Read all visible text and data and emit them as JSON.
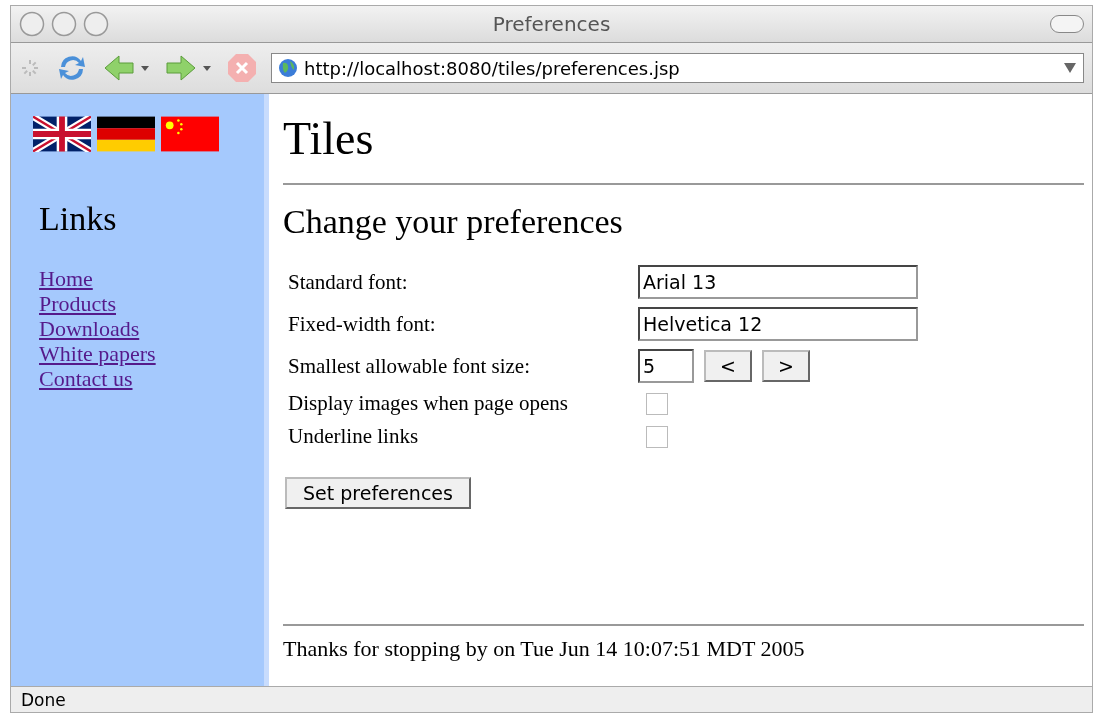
{
  "window": {
    "title": "Preferences"
  },
  "toolbar": {
    "url": "http://localhost:8080/tiles/preferences.jsp"
  },
  "sidebar": {
    "flags": [
      {
        "kind": "uk"
      },
      {
        "kind": "de"
      },
      {
        "kind": "cn"
      }
    ],
    "heading": "Links",
    "links": [
      "Home",
      "Products",
      "Downloads",
      "White papers",
      "Contact us"
    ]
  },
  "main": {
    "title": "Tiles",
    "heading": "Change your preferences",
    "form": [
      {
        "kind": "text",
        "label": "Standard font:",
        "value": "Arial 13"
      },
      {
        "kind": "text",
        "label": "Fixed-width font:",
        "value": "Helvetica 12"
      },
      {
        "kind": "stepper",
        "label": "Smallest allowable font size:",
        "value": "5",
        "buttons": [
          "<",
          ">"
        ]
      },
      {
        "kind": "checkbox",
        "label": "Display images when page opens",
        "checked": false
      },
      {
        "kind": "checkbox",
        "label": "Underline links",
        "checked": false
      }
    ],
    "submit": "Set preferences",
    "footer": "Thanks for stopping by on Tue Jun 14 10:07:51 MDT 2005"
  },
  "status_bar": {
    "text": "Done"
  }
}
